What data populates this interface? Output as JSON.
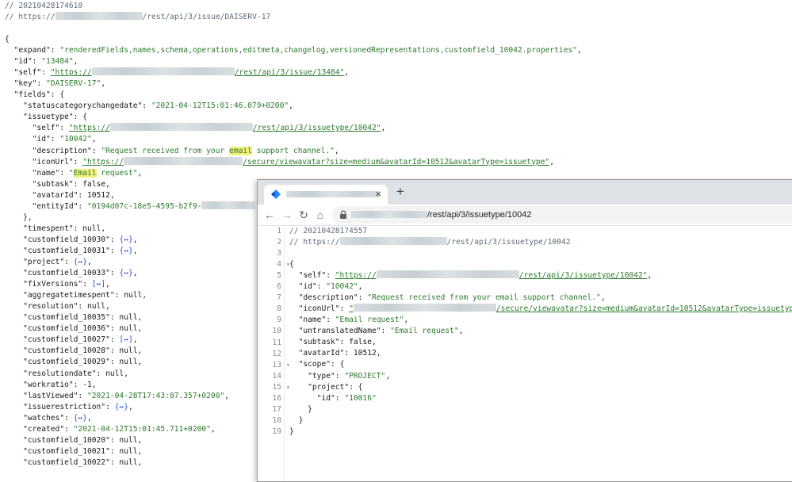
{
  "background_json": {
    "comment_timestamp": "// 20210428174610",
    "comment_url_prefix": "// https://",
    "comment_url_suffix": "/rest/api/3/issue/DAISERV-17",
    "lines": [
      {
        "i": 0,
        "t": "{"
      },
      {
        "i": 1,
        "k": "\"expand\"",
        "s": "\"renderedFields,names,schema,operations,editmeta,changelog,versionedRepresentations,customfield_10042.properties\"",
        "end": ","
      },
      {
        "i": 1,
        "k": "\"id\"",
        "s": "\"13484\"",
        "end": ","
      },
      {
        "i": 1,
        "k": "\"self\"",
        "link_pre": "\"https://",
        "link_post": "/rest/api/3/issue/13484\"",
        "end": ","
      },
      {
        "i": 1,
        "k": "\"key\"",
        "s": "\"DAISERV-17\"",
        "end": ","
      },
      {
        "i": 1,
        "k": "\"fields\"",
        "raw": "{"
      },
      {
        "i": 2,
        "k": "\"statuscategorychangedate\"",
        "s": "\"2021-04-12T15:01:46.079+0200\"",
        "end": ","
      },
      {
        "i": 2,
        "k": "\"issuetype\"",
        "raw": "{"
      },
      {
        "i": 3,
        "k": "\"self\"",
        "link_pre": "\"https://",
        "link_post": "/rest/api/3/issuetype/10042\"",
        "end": ","
      },
      {
        "i": 3,
        "k": "\"id\"",
        "s": "\"10042\"",
        "end": ","
      },
      {
        "i": 3,
        "k": "\"description\"",
        "s_pre": "\"Request received from your ",
        "s_hl": "email",
        "s_post": " support channel.\"",
        "end": ","
      },
      {
        "i": 3,
        "k": "\"iconUrl\"",
        "link_pre": "\"https://",
        "link_post": "/secure/viewavatar?size=medium&avatarId=10512&avatarType=issuetype\"",
        "end": ","
      },
      {
        "i": 3,
        "k": "\"name\"",
        "s_pre": "\"",
        "s_hl": "Email",
        "s_post": " request\"",
        "end": ","
      },
      {
        "i": 3,
        "k": "\"subtask\"",
        "raw": "false",
        "end": ","
      },
      {
        "i": 3,
        "k": "\"avatarId\"",
        "raw": "10512",
        "end": ","
      },
      {
        "i": 3,
        "k": "\"entityId\"",
        "s_pre": "\"0194d07c-18e5-4595-b2f9-",
        "blur_s": true,
        "s_post": "\""
      },
      {
        "i": 2,
        "t": "},"
      },
      {
        "i": 2,
        "k": "\"timespent\"",
        "raw": "null",
        "end": ","
      },
      {
        "i": 2,
        "k": "\"customfield_10030\"",
        "col": "{↔}",
        "end": ","
      },
      {
        "i": 2,
        "k": "\"customfield_10031\"",
        "col": "{↔}",
        "end": ","
      },
      {
        "i": 2,
        "k": "\"project\"",
        "col": "{↔}",
        "end": ","
      },
      {
        "i": 2,
        "k": "\"customfield_10033\"",
        "col": "{↔}",
        "end": ","
      },
      {
        "i": 2,
        "k": "\"fixVersions\"",
        "col": "[↔]",
        "end": ","
      },
      {
        "i": 2,
        "k": "\"aggregatetimespent\"",
        "raw": "null",
        "end": ","
      },
      {
        "i": 2,
        "k": "\"resolution\"",
        "raw": "null",
        "end": ","
      },
      {
        "i": 2,
        "k": "\"customfield_10035\"",
        "raw": "null",
        "end": ","
      },
      {
        "i": 2,
        "k": "\"customfield_10036\"",
        "raw": "null",
        "end": ","
      },
      {
        "i": 2,
        "k": "\"customfield_10027\"",
        "col": "[↔]",
        "end": ","
      },
      {
        "i": 2,
        "k": "\"customfield_10028\"",
        "raw": "null",
        "end": ","
      },
      {
        "i": 2,
        "k": "\"customfield_10029\"",
        "raw": "null",
        "end": ","
      },
      {
        "i": 2,
        "k": "\"resolutiondate\"",
        "raw": "null",
        "end": ","
      },
      {
        "i": 2,
        "k": "\"workratio\"",
        "raw": "-1",
        "end": ","
      },
      {
        "i": 2,
        "k": "\"lastViewed\"",
        "s": "\"2021-04-28T17:43:07.357+0200\"",
        "end": ","
      },
      {
        "i": 2,
        "k": "\"issuerestriction\"",
        "col": "{↔}",
        "end": ","
      },
      {
        "i": 2,
        "k": "\"watches\"",
        "col": "{↔}",
        "end": ","
      },
      {
        "i": 2,
        "k": "\"created\"",
        "s": "\"2021-04-12T15:01:45.711+0200\"",
        "end": ","
      },
      {
        "i": 2,
        "k": "\"customfield_10020\"",
        "raw": "null",
        "end": ","
      },
      {
        "i": 2,
        "k": "\"customfield_10021\"",
        "raw": "null",
        "end": ","
      },
      {
        "i": 2,
        "k": "\"customfield_10022\"",
        "raw": "null",
        "end": ","
      }
    ]
  },
  "browser": {
    "tab_close": "×",
    "new_tab": "+",
    "back": "←",
    "forward": "→",
    "reload": "↻",
    "home": "⌂",
    "url_suffix": "/rest/api/3/issuetype/10042",
    "colors": {
      "tabbar": "#dee1e6",
      "favicon": "#2684ff",
      "string": "#2d7a2d",
      "collapsed": "#2b56d6"
    }
  },
  "front_json": {
    "line_numbers": [
      "1",
      "2",
      "3",
      "4",
      "5",
      "6",
      "7",
      "8",
      "9",
      "10",
      "11",
      "12",
      "13",
      "14",
      "15",
      "16",
      "17",
      "18",
      "19"
    ],
    "fold_markers": {
      "4": "▾",
      "13": "▾",
      "15": "▾"
    },
    "comment_timestamp": "// 20210428174557",
    "comment_url_prefix": "// https://",
    "comment_url_suffix": "/rest/api/3/issuetype/10042",
    "lines": [
      {
        "i": 0,
        "t": "{"
      },
      {
        "i": 1,
        "k": "\"self\"",
        "link_pre": "\"https://",
        "link_post": "/rest/api/3/issuetype/10042\"",
        "end": ","
      },
      {
        "i": 1,
        "k": "\"id\"",
        "s": "\"10042\"",
        "end": ","
      },
      {
        "i": 1,
        "k": "\"description\"",
        "s": "\"Request received from your email support channel.\"",
        "end": ","
      },
      {
        "i": 1,
        "k": "\"iconUrl\"",
        "link_pre": "\"",
        "link_post": "/secure/viewavatar?size=medium&avatarId=10512&avatarType=issuetype\"",
        "end": ","
      },
      {
        "i": 1,
        "k": "\"name\"",
        "s": "\"Email request\"",
        "end": ","
      },
      {
        "i": 1,
        "k": "\"untranslatedName\"",
        "s": "\"Email request\"",
        "end": ","
      },
      {
        "i": 1,
        "k": "\"subtask\"",
        "raw": "false",
        "end": ","
      },
      {
        "i": 1,
        "k": "\"avatarId\"",
        "raw": "10512",
        "end": ","
      },
      {
        "i": 1,
        "k": "\"scope\"",
        "raw": "{"
      },
      {
        "i": 2,
        "k": "\"type\"",
        "s": "\"PROJECT\"",
        "end": ","
      },
      {
        "i": 2,
        "k": "\"project\"",
        "raw": "{"
      },
      {
        "i": 3,
        "k": "\"id\"",
        "s": "\"10016\""
      },
      {
        "i": 2,
        "t": "}"
      },
      {
        "i": 1,
        "t": "}"
      },
      {
        "i": 0,
        "t": "}"
      }
    ]
  }
}
